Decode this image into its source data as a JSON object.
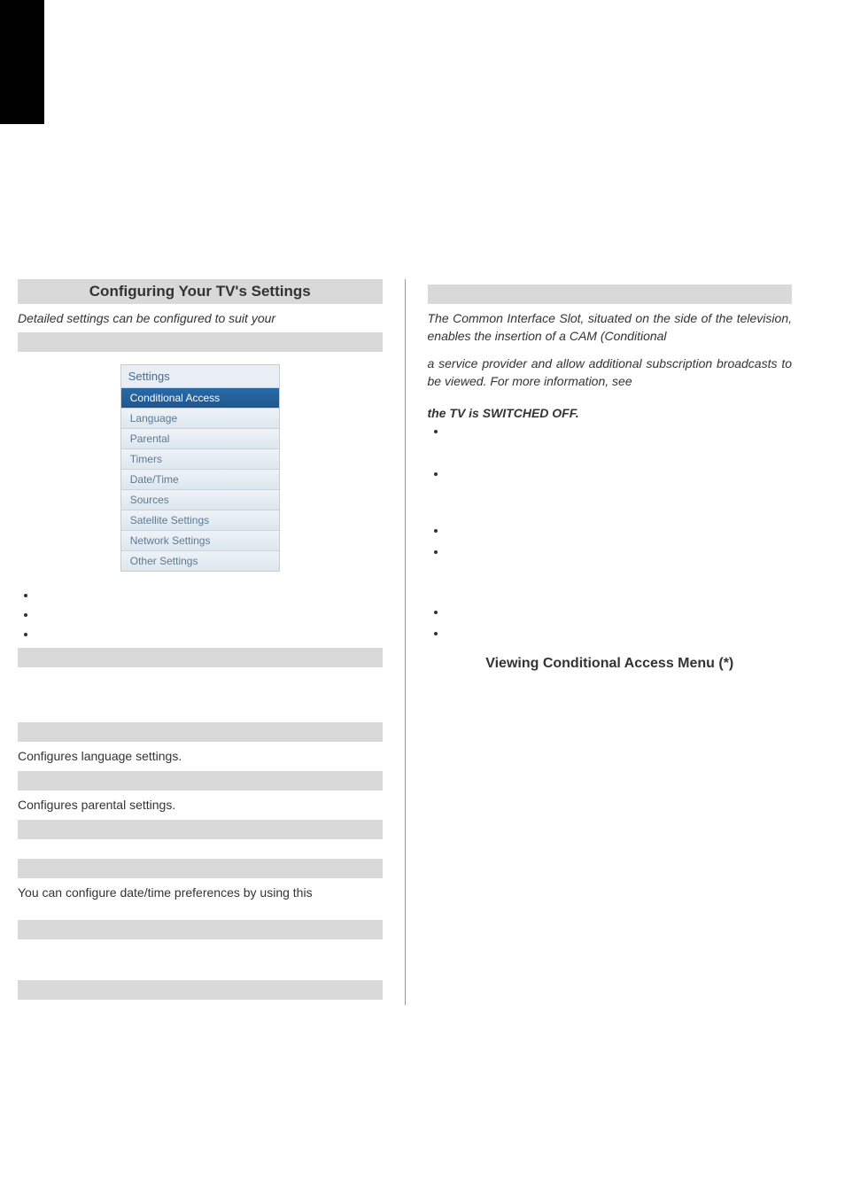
{
  "left": {
    "heading": "Configuring Your TV's Settings",
    "intro": "Detailed settings can be configured to suit your",
    "menu": {
      "title": "Settings",
      "items": [
        "Conditional Access",
        "Language",
        "Parental",
        "Timers",
        "Date/Time",
        "Sources",
        "Satellite Settings",
        "Network Settings",
        "Other Settings"
      ]
    },
    "sub_lang_desc": "Configures language settings.",
    "sub_parental_desc": "Configures parental settings.",
    "sub_datetime_desc": "You can configure date/time preferences by using this"
  },
  "right": {
    "p1": "The Common Interface Slot, situated on the side of the television, enables the insertion of a CAM (Conditional",
    "p2": "a service provider and allow additional subscription broadcasts to be viewed. For more information, see",
    "bold_line": "the TV is SWITCHED OFF.",
    "cam_heading": "Viewing Conditional Access Menu (*)"
  }
}
